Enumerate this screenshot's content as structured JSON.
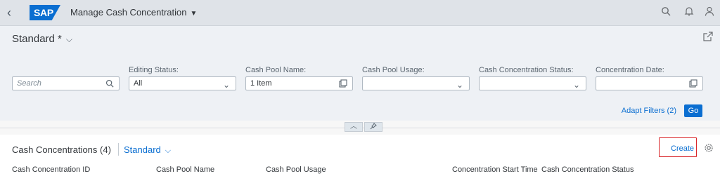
{
  "shell": {
    "app_title": "Manage Cash Concentration",
    "logo_text": "SAP",
    "icons": [
      "back-icon",
      "search-icon",
      "notifications-icon",
      "user-icon"
    ]
  },
  "header": {
    "variant_name": "Standard *"
  },
  "filterbar": {
    "search_placeholder": "Search",
    "fields": [
      {
        "label": "Editing Status:",
        "value": "All",
        "type": "select"
      },
      {
        "label": "Cash Pool Name:",
        "value": "1 Item",
        "type": "value-help"
      },
      {
        "label": "Cash Pool Usage:",
        "value": "",
        "type": "select"
      },
      {
        "label": "Cash Concentration Status:",
        "value": "",
        "type": "select"
      },
      {
        "label": "Concentration Date:",
        "value": "",
        "type": "value-help"
      }
    ],
    "adapt_filters_label": "Adapt Filters (2)",
    "go_label": "Go"
  },
  "table": {
    "title": "Cash Concentrations (4)",
    "variant": "Standard",
    "create_label": "Create",
    "columns": [
      "Cash Concentration ID",
      "Cash Pool Name",
      "Cash Pool Usage",
      "Concentration Start Time",
      "Cash Concentration Status"
    ]
  },
  "colors": {
    "accent": "#0a6ed1",
    "highlight_border": "#d9262a",
    "shell_bg": "#dfe3e8"
  }
}
